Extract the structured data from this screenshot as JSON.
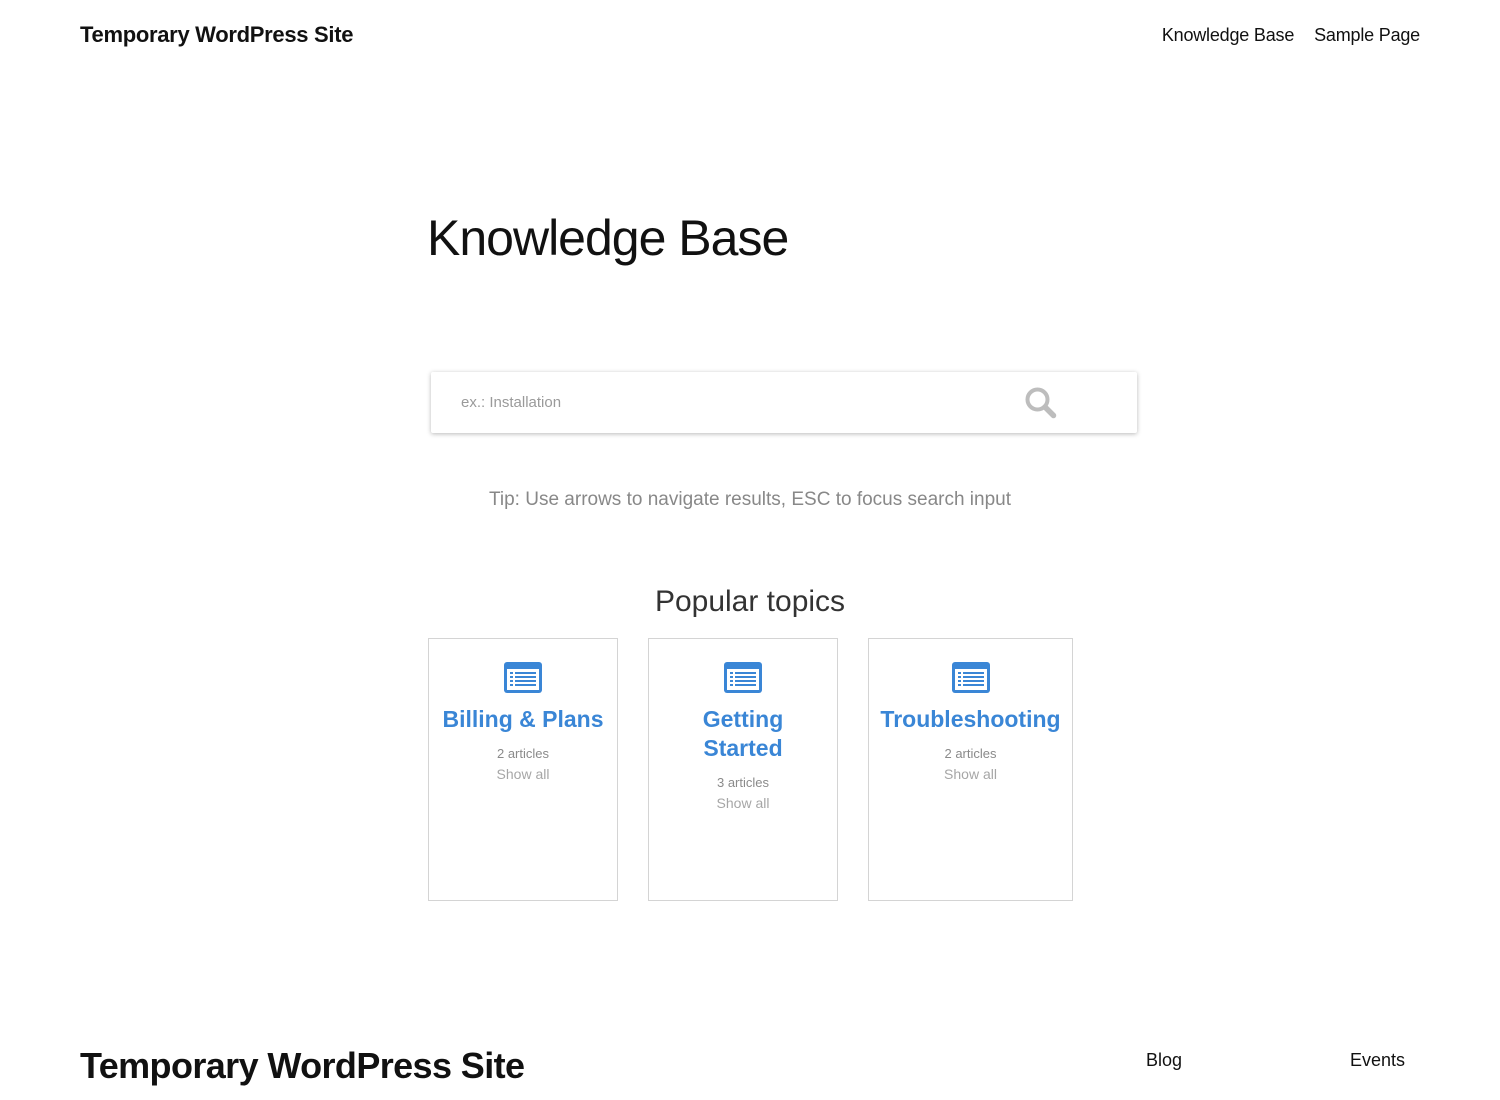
{
  "header": {
    "site_title": "Temporary WordPress Site",
    "nav": [
      "Knowledge Base",
      "Sample Page"
    ]
  },
  "main": {
    "title": "Knowledge Base",
    "search": {
      "placeholder": "ex.: Installation",
      "value": "",
      "icon": "search-icon"
    },
    "tip": "Tip: Use arrows to navigate results, ESC to focus search input",
    "popular": {
      "heading": "Popular topics",
      "topics": [
        {
          "title": "Billing & Plans",
          "count": "2 articles",
          "link": "Show all",
          "icon": "document-list-icon"
        },
        {
          "title": "Getting Started",
          "count": "3 articles",
          "link": "Show all",
          "icon": "document-list-icon"
        },
        {
          "title": "Troubleshooting",
          "count": "2 articles",
          "link": "Show all",
          "icon": "document-list-icon"
        }
      ]
    }
  },
  "footer": {
    "site_title": "Temporary WordPress Site",
    "links": [
      "Blog",
      "Events"
    ]
  },
  "colors": {
    "accent": "#3a86d6",
    "text": "#111111",
    "muted": "#888888",
    "border": "#d4d4d4"
  }
}
